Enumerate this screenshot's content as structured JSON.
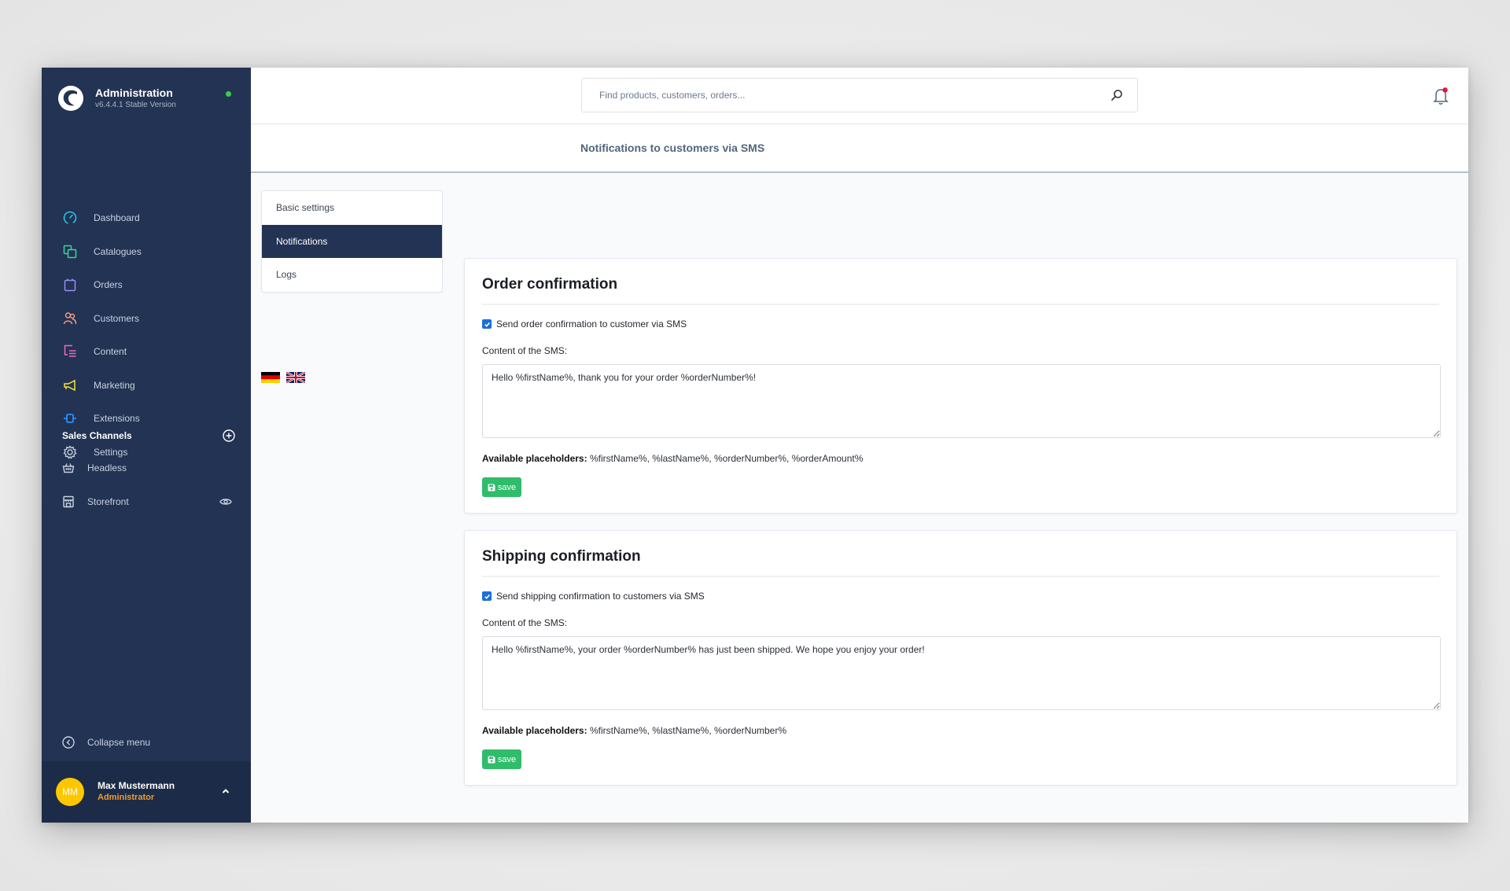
{
  "sidebar": {
    "app_title": "Administration",
    "version": "v6.4.4.1 Stable Version",
    "status_color": "#37d046",
    "nav": [
      {
        "label": "Dashboard",
        "icon": "dashboard-icon",
        "color": "#2ec7e6"
      },
      {
        "label": "Catalogues",
        "icon": "catalogues-icon",
        "color": "#3cd39b"
      },
      {
        "label": "Orders",
        "icon": "orders-icon",
        "color": "#9d8cf5"
      },
      {
        "label": "Customers",
        "icon": "customers-icon",
        "color": "#f49b7d"
      },
      {
        "label": "Content",
        "icon": "content-icon",
        "color": "#f067c0"
      },
      {
        "label": "Marketing",
        "icon": "marketing-icon",
        "color": "#f7e13b"
      },
      {
        "label": "Extensions",
        "icon": "extensions-icon",
        "color": "#2b8ef6"
      },
      {
        "label": "Settings",
        "icon": "settings-icon",
        "color": "#c3cbd8"
      }
    ],
    "sales_channels": {
      "label": "Sales Channels",
      "items": [
        {
          "label": "Headless",
          "icon": "basket-icon"
        },
        {
          "label": "Storefront",
          "icon": "storefront-icon"
        }
      ]
    },
    "collapse_label": "Collapse menu",
    "user": {
      "initials": "MM",
      "name": "Max Mustermann",
      "role": "Administrator"
    }
  },
  "header": {
    "search_placeholder": "Find products, customers, orders...",
    "page_title": "Notifications to customers via SMS"
  },
  "tabs": [
    {
      "label": "Basic settings",
      "active": false
    },
    {
      "label": "Notifications",
      "active": true
    },
    {
      "label": "Logs",
      "active": false
    }
  ],
  "languages": [
    "de",
    "en"
  ],
  "cards": [
    {
      "title": "Order confirmation",
      "checkbox_label": "Send order confirmation to customer via SMS",
      "checked": true,
      "field_label": "Content of the SMS:",
      "sms_content": "Hello %firstName%, thank you for your order %orderNumber%!",
      "placeholders_label": "Available placeholders:",
      "placeholders": "%firstName%, %lastName%, %orderNumber%, %orderAmount%",
      "save_label": "save"
    },
    {
      "title": "Shipping confirmation",
      "checkbox_label": "Send shipping confirmation to customers via SMS",
      "checked": true,
      "field_label": "Content of the SMS:",
      "sms_content": "Hello %firstName%, your order %orderNumber% has just been shipped. We hope you enjoy your order!",
      "placeholders_label": "Available placeholders:",
      "placeholders": "%firstName%, %lastName%, %orderNumber%",
      "save_label": "save"
    }
  ],
  "colors": {
    "sidebar_bg": "#223354",
    "accent_save": "#2fbd6b",
    "checkbox": "#1d6fd8",
    "role": "#f39a2c",
    "avatar": "#ffc700",
    "notification_dot": "#e6123d"
  }
}
